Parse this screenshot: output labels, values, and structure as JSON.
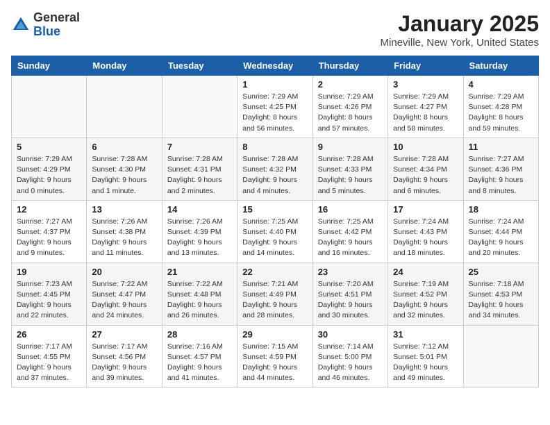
{
  "header": {
    "logo_general": "General",
    "logo_blue": "Blue",
    "title": "January 2025",
    "subtitle": "Mineville, New York, United States"
  },
  "days_of_week": [
    "Sunday",
    "Monday",
    "Tuesday",
    "Wednesday",
    "Thursday",
    "Friday",
    "Saturday"
  ],
  "weeks": [
    [
      {
        "day": "",
        "info": ""
      },
      {
        "day": "",
        "info": ""
      },
      {
        "day": "",
        "info": ""
      },
      {
        "day": "1",
        "info": "Sunrise: 7:29 AM\nSunset: 4:25 PM\nDaylight: 8 hours\nand 56 minutes."
      },
      {
        "day": "2",
        "info": "Sunrise: 7:29 AM\nSunset: 4:26 PM\nDaylight: 8 hours\nand 57 minutes."
      },
      {
        "day": "3",
        "info": "Sunrise: 7:29 AM\nSunset: 4:27 PM\nDaylight: 8 hours\nand 58 minutes."
      },
      {
        "day": "4",
        "info": "Sunrise: 7:29 AM\nSunset: 4:28 PM\nDaylight: 8 hours\nand 59 minutes."
      }
    ],
    [
      {
        "day": "5",
        "info": "Sunrise: 7:29 AM\nSunset: 4:29 PM\nDaylight: 9 hours\nand 0 minutes."
      },
      {
        "day": "6",
        "info": "Sunrise: 7:28 AM\nSunset: 4:30 PM\nDaylight: 9 hours\nand 1 minute."
      },
      {
        "day": "7",
        "info": "Sunrise: 7:28 AM\nSunset: 4:31 PM\nDaylight: 9 hours\nand 2 minutes."
      },
      {
        "day": "8",
        "info": "Sunrise: 7:28 AM\nSunset: 4:32 PM\nDaylight: 9 hours\nand 4 minutes."
      },
      {
        "day": "9",
        "info": "Sunrise: 7:28 AM\nSunset: 4:33 PM\nDaylight: 9 hours\nand 5 minutes."
      },
      {
        "day": "10",
        "info": "Sunrise: 7:28 AM\nSunset: 4:34 PM\nDaylight: 9 hours\nand 6 minutes."
      },
      {
        "day": "11",
        "info": "Sunrise: 7:27 AM\nSunset: 4:36 PM\nDaylight: 9 hours\nand 8 minutes."
      }
    ],
    [
      {
        "day": "12",
        "info": "Sunrise: 7:27 AM\nSunset: 4:37 PM\nDaylight: 9 hours\nand 9 minutes."
      },
      {
        "day": "13",
        "info": "Sunrise: 7:26 AM\nSunset: 4:38 PM\nDaylight: 9 hours\nand 11 minutes."
      },
      {
        "day": "14",
        "info": "Sunrise: 7:26 AM\nSunset: 4:39 PM\nDaylight: 9 hours\nand 13 minutes."
      },
      {
        "day": "15",
        "info": "Sunrise: 7:25 AM\nSunset: 4:40 PM\nDaylight: 9 hours\nand 14 minutes."
      },
      {
        "day": "16",
        "info": "Sunrise: 7:25 AM\nSunset: 4:42 PM\nDaylight: 9 hours\nand 16 minutes."
      },
      {
        "day": "17",
        "info": "Sunrise: 7:24 AM\nSunset: 4:43 PM\nDaylight: 9 hours\nand 18 minutes."
      },
      {
        "day": "18",
        "info": "Sunrise: 7:24 AM\nSunset: 4:44 PM\nDaylight: 9 hours\nand 20 minutes."
      }
    ],
    [
      {
        "day": "19",
        "info": "Sunrise: 7:23 AM\nSunset: 4:45 PM\nDaylight: 9 hours\nand 22 minutes."
      },
      {
        "day": "20",
        "info": "Sunrise: 7:22 AM\nSunset: 4:47 PM\nDaylight: 9 hours\nand 24 minutes."
      },
      {
        "day": "21",
        "info": "Sunrise: 7:22 AM\nSunset: 4:48 PM\nDaylight: 9 hours\nand 26 minutes."
      },
      {
        "day": "22",
        "info": "Sunrise: 7:21 AM\nSunset: 4:49 PM\nDaylight: 9 hours\nand 28 minutes."
      },
      {
        "day": "23",
        "info": "Sunrise: 7:20 AM\nSunset: 4:51 PM\nDaylight: 9 hours\nand 30 minutes."
      },
      {
        "day": "24",
        "info": "Sunrise: 7:19 AM\nSunset: 4:52 PM\nDaylight: 9 hours\nand 32 minutes."
      },
      {
        "day": "25",
        "info": "Sunrise: 7:18 AM\nSunset: 4:53 PM\nDaylight: 9 hours\nand 34 minutes."
      }
    ],
    [
      {
        "day": "26",
        "info": "Sunrise: 7:17 AM\nSunset: 4:55 PM\nDaylight: 9 hours\nand 37 minutes."
      },
      {
        "day": "27",
        "info": "Sunrise: 7:17 AM\nSunset: 4:56 PM\nDaylight: 9 hours\nand 39 minutes."
      },
      {
        "day": "28",
        "info": "Sunrise: 7:16 AM\nSunset: 4:57 PM\nDaylight: 9 hours\nand 41 minutes."
      },
      {
        "day": "29",
        "info": "Sunrise: 7:15 AM\nSunset: 4:59 PM\nDaylight: 9 hours\nand 44 minutes."
      },
      {
        "day": "30",
        "info": "Sunrise: 7:14 AM\nSunset: 5:00 PM\nDaylight: 9 hours\nand 46 minutes."
      },
      {
        "day": "31",
        "info": "Sunrise: 7:12 AM\nSunset: 5:01 PM\nDaylight: 9 hours\nand 49 minutes."
      },
      {
        "day": "",
        "info": ""
      }
    ]
  ]
}
